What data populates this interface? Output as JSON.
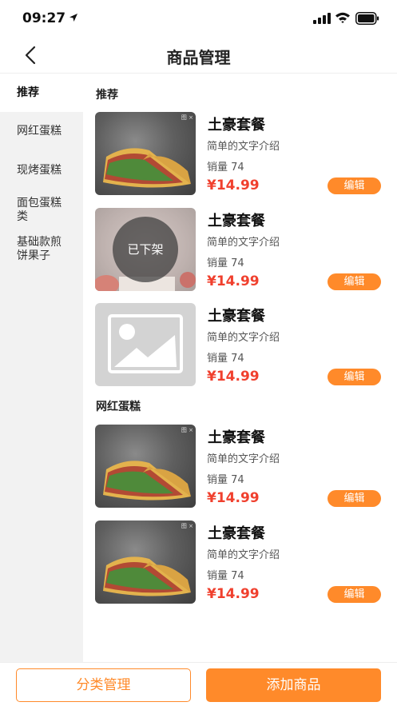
{
  "status_bar": {
    "time": "09:27"
  },
  "header": {
    "title": "商品管理"
  },
  "sidebar": {
    "categories": [
      {
        "label": "推荐",
        "active": true
      },
      {
        "label": "网红蛋糕",
        "active": false
      },
      {
        "label": "现烤蛋糕",
        "active": false
      },
      {
        "label": "面包蛋糕类",
        "active": false
      },
      {
        "label": "基础款煎饼果子",
        "active": false
      }
    ]
  },
  "sections": [
    {
      "title": "推荐",
      "products": [
        {
          "name": "土豪套餐",
          "desc": "简单的文字介绍",
          "sales": "销量 74",
          "price": "¥14.99",
          "edit": "编辑",
          "image": "food-photo",
          "ad_mark": "图 ×"
        },
        {
          "name": "土豪套餐",
          "desc": "简单的文字介绍",
          "sales": "销量 74",
          "price": "¥14.99",
          "edit": "编辑",
          "image": "food-photo-offshelf",
          "status": "已下架"
        },
        {
          "name": "土豪套餐",
          "desc": "简单的文字介绍",
          "sales": "销量 74",
          "price": "¥14.99",
          "edit": "编辑",
          "image": "image-placeholder-icon"
        }
      ]
    },
    {
      "title": "网红蛋糕",
      "products": [
        {
          "name": "土豪套餐",
          "desc": "简单的文字介绍",
          "sales": "销量 74",
          "price": "¥14.99",
          "edit": "编辑",
          "image": "food-photo",
          "ad_mark": "图 ×"
        },
        {
          "name": "土豪套餐",
          "desc": "简单的文字介绍",
          "sales": "销量 74",
          "price": "¥14.99",
          "edit": "编辑",
          "image": "food-photo",
          "ad_mark": "图 ×"
        }
      ]
    }
  ],
  "footer": {
    "category_button": "分类管理",
    "add_button": "添加商品"
  },
  "colors": {
    "accent": "#ff8a2a",
    "price": "#f0402e",
    "sidebar_bg": "#f2f2f2"
  }
}
